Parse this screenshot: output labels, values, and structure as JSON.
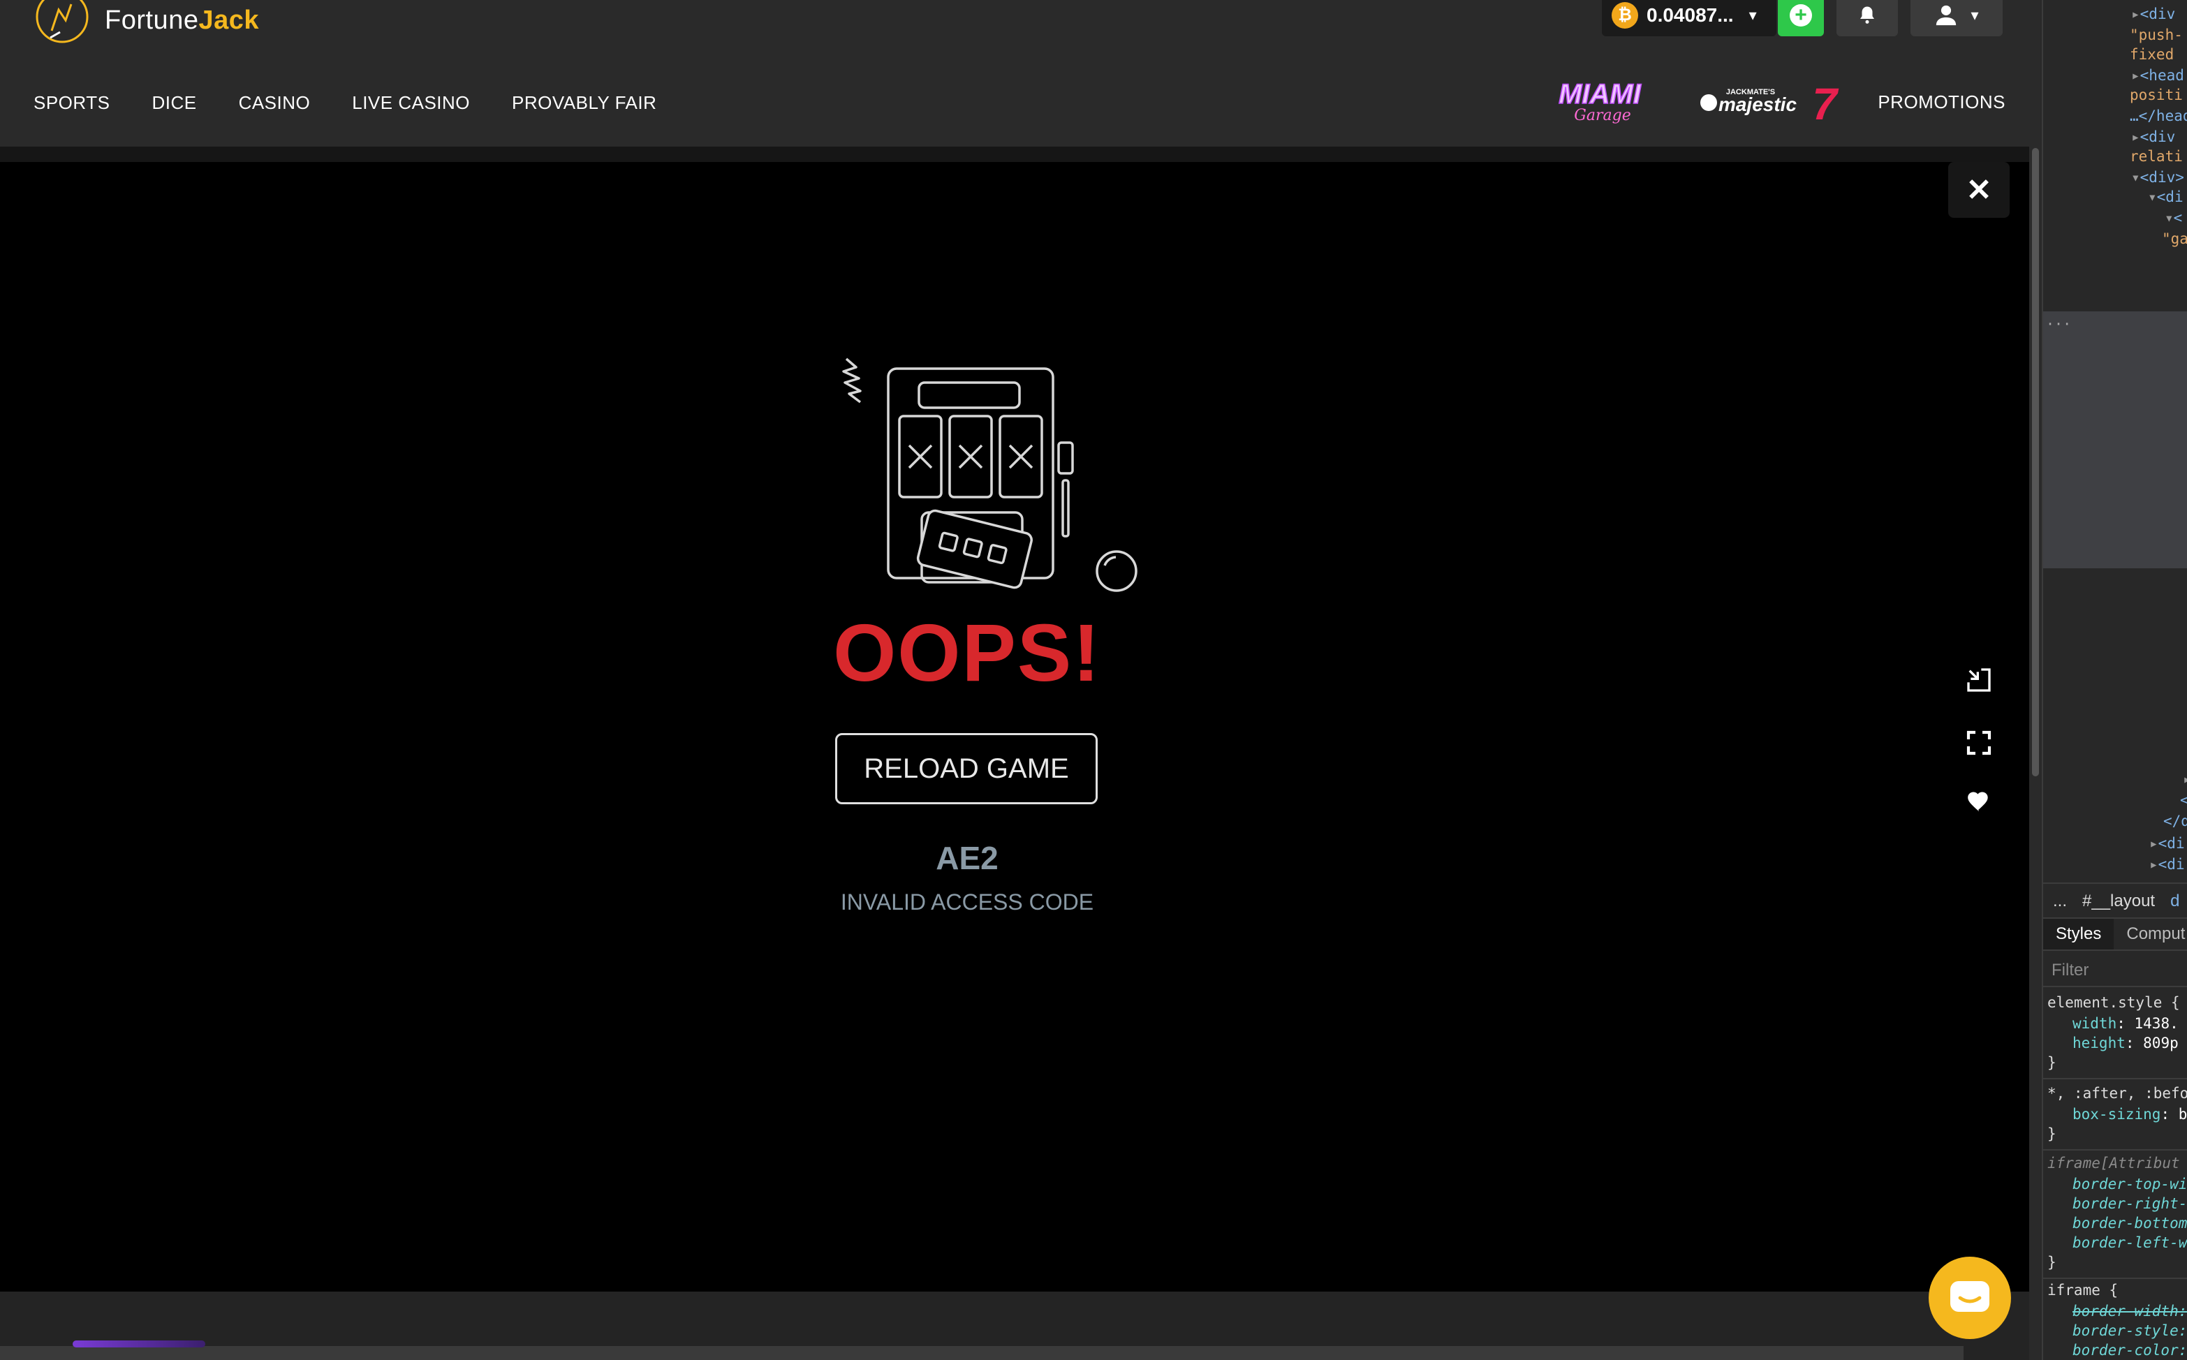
{
  "header": {
    "logo_word_1": "Fortune",
    "logo_word_2": "Jack",
    "balance": "0.04087...",
    "currency_icon": "bitcoin-icon",
    "deposit_icon": "plus-icon",
    "notifications_icon": "bell-icon",
    "user_icon": "user-icon"
  },
  "nav": {
    "items": [
      "SPORTS",
      "DICE",
      "CASINO",
      "LIVE CASINO",
      "PROVABLY FAIR"
    ],
    "promo_brand_1": "Miami Garage",
    "promo_brand_2": "Jackmate's Majestic 7",
    "promotions": "PROMOTIONS"
  },
  "game": {
    "title": "OOPS!",
    "reload_label": "RELOAD GAME",
    "error_code": "AE2",
    "error_message": "INVALID ACCESS CODE",
    "controls": [
      "close-icon",
      "minimize-icon",
      "fullscreen-icon",
      "heart-icon"
    ]
  },
  "devtools": {
    "dom_lines": [
      {
        "t": "▸",
        "c": "<div "
      },
      {
        "t": "",
        "c": "\"push-"
      },
      {
        "t": "",
        "c": "fixed "
      },
      {
        "t": "▸",
        "c": "<head"
      },
      {
        "t": "",
        "c": "positi"
      },
      {
        "t": "",
        "c": "…</head"
      },
      {
        "t": "▸",
        "c": "<div "
      },
      {
        "t": "",
        "c": "relati"
      },
      {
        "t": "▾",
        "c": "<div>"
      },
      {
        "t": "▾",
        "c": "<di"
      },
      {
        "t": "▾",
        "c": "<"
      },
      {
        "t": "",
        "c": "\"ga"
      }
    ],
    "dom_lines_low": [
      "▸",
      "<",
      "</d",
      "<di",
      "<di"
    ],
    "breadcrumb_more": "...",
    "breadcrumb_item": "#__layout",
    "breadcrumb_next": "d",
    "tab_styles": "Styles",
    "tab_computed": "Comput",
    "filter_placeholder": "Filter",
    "rules": {
      "element_style_selector": "element.style {",
      "width_prop": "width",
      "width_val": "1438.",
      "height_prop": "height",
      "height_val": "809p",
      "universal_selector": "*, :after, :befo",
      "box_sizing_prop": "box-sizing",
      "box_sizing_val": "b",
      "iframe_attr_selector": "iframe[Attribut",
      "border_top": "border-top-wi",
      "border_right": "border-right-",
      "border_bottom": "border-bottom",
      "border_left": "border-left-w",
      "iframe_selector": "iframe {",
      "border_width": "border-width:",
      "border_style": "border-style:",
      "border_color": "border-color:",
      "close_brace": "}"
    }
  },
  "colors": {
    "accent_gold": "#f5b81e",
    "error_red": "#d8282c",
    "deposit_green": "#2ec84a",
    "error_text_grey": "#8a9aa6"
  }
}
